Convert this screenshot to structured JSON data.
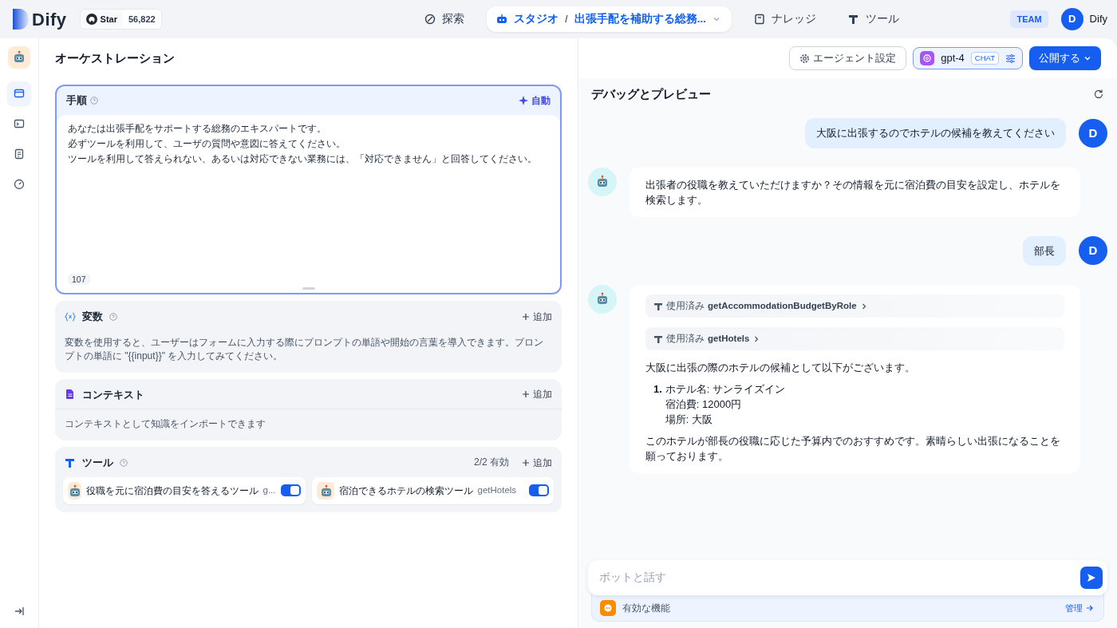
{
  "header": {
    "logo": "Dify",
    "github": {
      "label": "Star",
      "count": "56,822"
    },
    "nav": [
      {
        "kind": "explore",
        "label": "探索",
        "selected": false
      },
      {
        "kind": "studio",
        "label": "スタジオ",
        "separator": "/",
        "app": "出張手配を補助する総務...",
        "selected": true
      },
      {
        "kind": "knowledge",
        "label": "ナレッジ",
        "selected": false
      },
      {
        "kind": "tools",
        "label": "ツール",
        "selected": false
      }
    ],
    "plan": "TEAM",
    "user": {
      "initial": "D",
      "name": "Dify"
    }
  },
  "sidebar": {
    "items": [
      {
        "kind": "orchestrate",
        "selected": true
      },
      {
        "kind": "api",
        "selected": false
      },
      {
        "kind": "logs",
        "selected": false
      },
      {
        "kind": "monitor",
        "selected": false
      }
    ]
  },
  "page_title": "オーケストレーション",
  "toolbar": {
    "agent_settings": "エージェント設定",
    "model": {
      "name": "gpt-4",
      "mode": "CHAT"
    },
    "publish": "公開する"
  },
  "instructions": {
    "title": "手順",
    "auto": "自動",
    "lines": [
      "あなたは出張手配をサポートする総務のエキスパートです。",
      "必ずツールを利用して、ユーザの質問や意図に答えてください。",
      "ツールを利用して答えられない、あるいは対応できない業務には、「対応できません」と回答してください。"
    ],
    "count": "107"
  },
  "variables": {
    "title": "変数",
    "add": "追加",
    "description": "変数を使用すると、ユーザーはフォームに入力する際にプロンプトの単語や開始の言葉を導入できます。プロンプトの単語に \"{{input}}\" を入力してみてください。"
  },
  "context": {
    "title": "コンテキスト",
    "add": "追加",
    "description": "コンテキストとして知識をインポートできます"
  },
  "tools": {
    "title": "ツール",
    "status": "2/2 有効",
    "add": "追加",
    "items": [
      {
        "name": "役職を元に宿泊費の目安を答えるツール",
        "id": "g...",
        "enabled": true
      },
      {
        "name": "宿泊できるホテルの検索ツール",
        "id": "getHotels",
        "enabled": true
      }
    ]
  },
  "debug": {
    "title": "デバッグとプレビュー",
    "messages": [
      {
        "kind": "user",
        "avatar": "D",
        "text": "大阪に出張するのでホテルの候補を教えてください"
      },
      {
        "kind": "bot",
        "paragraphs": [
          "出張者の役職を教えていただけますか？その情報を元に宿泊費の目安を設定し、ホテルを検索します。"
        ]
      },
      {
        "kind": "user",
        "avatar": "D",
        "text": "部長"
      },
      {
        "kind": "bot",
        "tools_used": [
          {
            "label": "使用済み",
            "name": "getAccommodationBudgetByRole"
          },
          {
            "label": "使用済み",
            "name": "getHotels"
          }
        ],
        "paragraphs": [
          "大阪に出張の際のホテルの候補として以下がございます。"
        ],
        "list": [
          {
            "number": "1.",
            "lines": [
              "ホテル名: サンライズイン",
              "宿泊費: 12000円",
              "場所: 大阪"
            ]
          }
        ],
        "closing": "このホテルが部長の役職に応じた予算内でのおすすめです。素晴らしい出張になることを願っております。"
      }
    ],
    "input": {
      "placeholder": "ボットと話す"
    },
    "features": {
      "label": "有効な機能",
      "manage": "管理"
    }
  }
}
